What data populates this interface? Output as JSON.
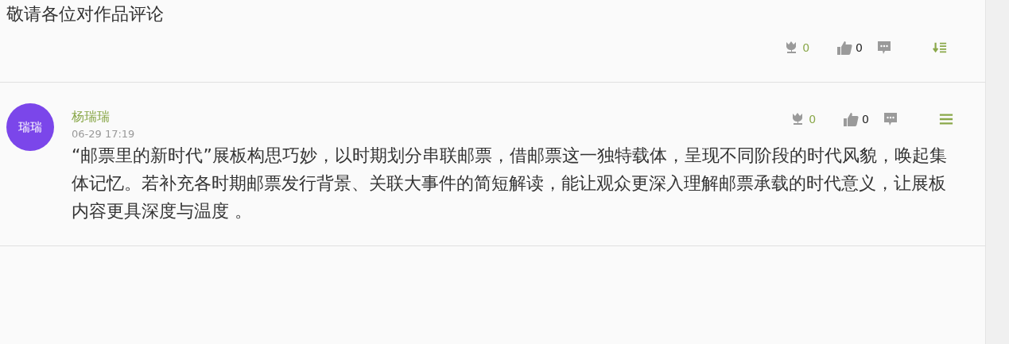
{
  "post": {
    "text": "敬请各位对作品评论",
    "flowers": "0",
    "likes": "0",
    "menu_icon": {
      "kind": "sort"
    }
  },
  "comments": [
    {
      "avatar": "瑞瑞",
      "name": "杨瑞瑞",
      "time": "06-29 17:19",
      "flowers": "0",
      "likes": "0",
      "menu_icon": {
        "kind": "more"
      },
      "text": "“邮票里的新时代”展板构思巧妙，以时期划分串联邮票，借邮票这一独特载体，呈现不同阶段的时代风貌，唤起集体记忆。若补充各时期邮票发行背景、关联大事件的简短解读，能让观众更深入理解邮票承载的时代意义，让展板内容更具深度与温度 。"
    }
  ]
}
